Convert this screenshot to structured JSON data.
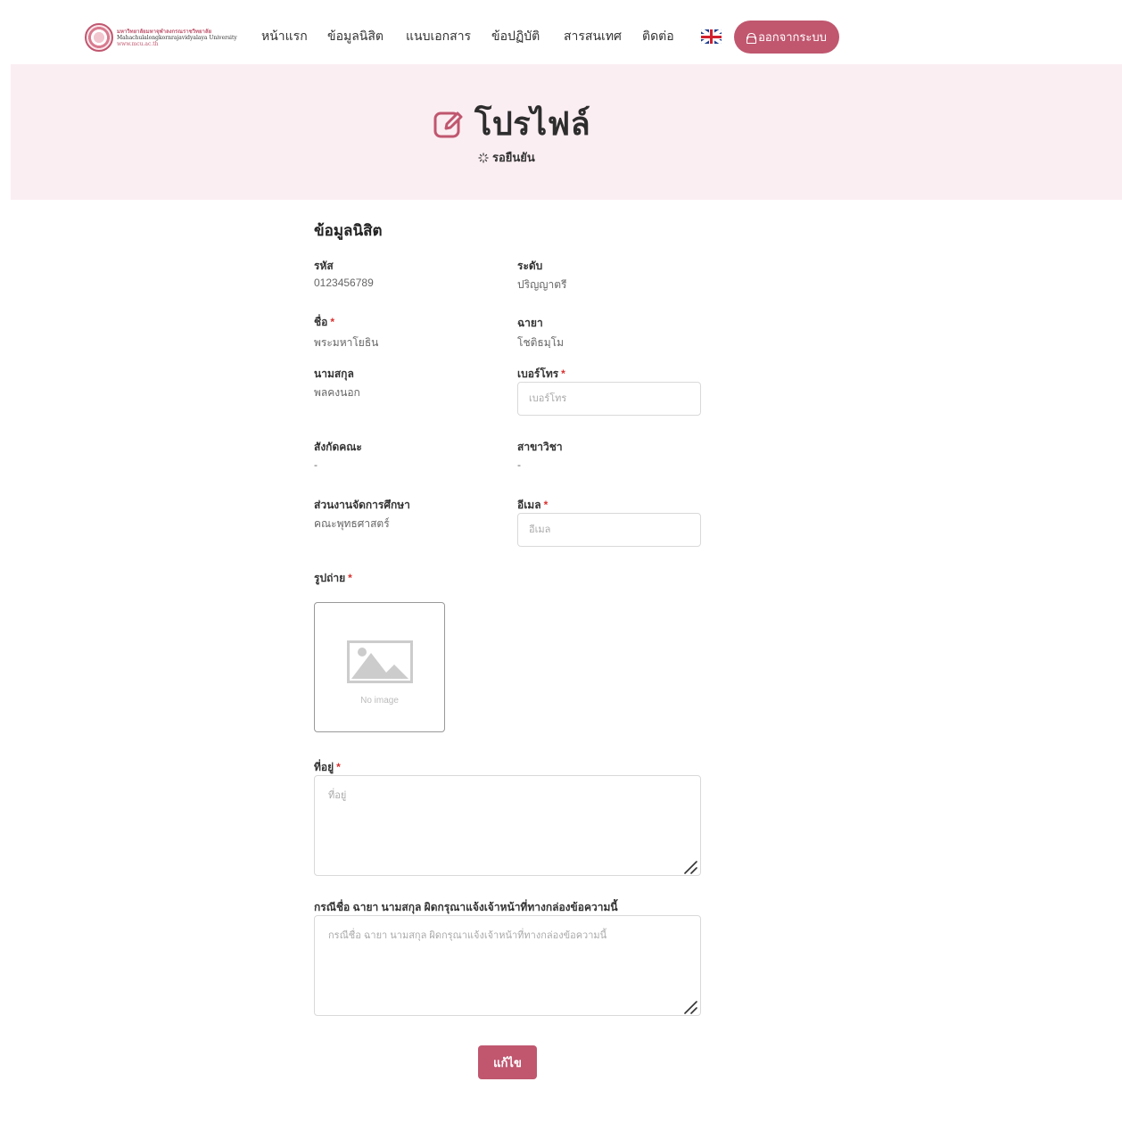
{
  "header": {
    "logo": {
      "line1": "มหาวิทยาลัยมหาจุฬาลงกรณราชวิทยาลัย",
      "line2": "Mahachulalongkornrajavidyalaya University",
      "line3": "www.mcu.ac.th"
    },
    "nav": [
      {
        "label": "หน้าแรก"
      },
      {
        "label": "ข้อมูลนิสิต"
      },
      {
        "label": "แนบเอกสาร"
      },
      {
        "label": "ข้อปฏิบัติ"
      },
      {
        "label": "สารสนเทศ"
      },
      {
        "label": "ติดต่อ"
      }
    ],
    "language_icon": "uk-flag-icon",
    "logout_label": "ออกจากระบบ"
  },
  "hero": {
    "title": "โปรไฟล์",
    "title_icon": "edit-icon",
    "status": "รอยืนยัน"
  },
  "form": {
    "section_title": "ข้อมูลนิสิต",
    "required_mark": "*",
    "student_id": {
      "label": "รหัส",
      "value": "0123456789"
    },
    "level": {
      "label": "ระดับ",
      "value": "ปริญญาตรี"
    },
    "name": {
      "label": "ชื่อ",
      "value": "พระมหาโยธิน"
    },
    "monastic_name": {
      "label": "ฉายา",
      "value": "โชติธมฺโม"
    },
    "surname": {
      "label": "นามสกุล",
      "value": "พลคงนอก"
    },
    "phone": {
      "label": "เบอร์โทร",
      "value": "",
      "placeholder": "เบอร์โทร"
    },
    "faculty": {
      "label": "สังกัดคณะ",
      "value": "-"
    },
    "major": {
      "label": "สาขาวิชา",
      "value": "-"
    },
    "unit": {
      "label": "ส่วนงานจัดการศึกษา",
      "value": "คณะพุทธศาสตร์"
    },
    "email": {
      "label": "อีเมล",
      "value": "",
      "placeholder": "อีเมล"
    },
    "photo": {
      "label": "รูปถ่าย",
      "no_image": "No image"
    },
    "address": {
      "label": "ที่อยู่",
      "value": "",
      "placeholder": "ที่อยู่"
    },
    "correction": {
      "label": "กรณีชื่อ ฉายา นามสกุล ผิดกรุณาแจ้งเจ้าหน้าที่ทางกล่องข้อความนี้",
      "value": "",
      "placeholder": "กรณีชื่อ ฉายา นามสกุล ผิดกรุณาแจ้งเจ้าหน้าที่ทางกล่องข้อความนี้"
    },
    "submit_label": "แก้ไข"
  },
  "colors": {
    "primary": "#c0576f",
    "hero_background": "#fbeef2",
    "required": "#d9302f"
  }
}
